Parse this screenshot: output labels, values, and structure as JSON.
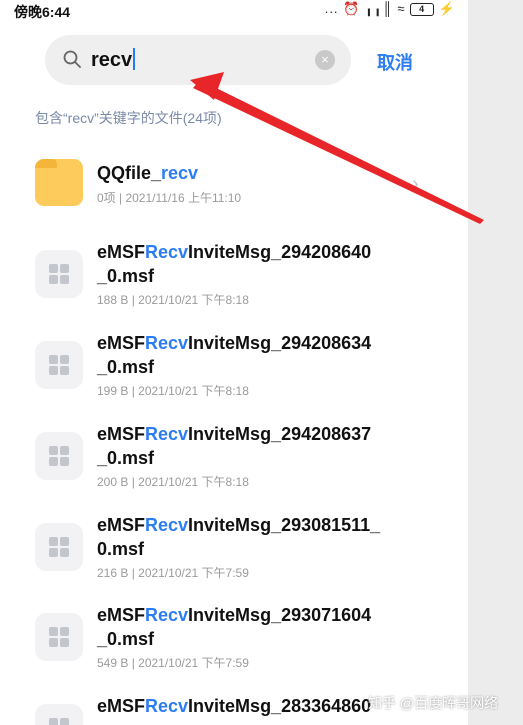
{
  "status_bar": {
    "time": "傍晚6:44",
    "icons": "... ⏰ ╻╻║ ≈",
    "battery": "4"
  },
  "search": {
    "query": "recv",
    "clear_symbol": "×",
    "cancel_label": "取消"
  },
  "summary": "包含“recv”关键字的文件(24项)",
  "items": [
    {
      "kind": "folder",
      "name_prefix": "QQfile_",
      "name_highlight": "recv",
      "name_suffix": "",
      "name_line2": "",
      "meta": "0项  |  2021/11/16 上午11:10"
    },
    {
      "kind": "file",
      "name_prefix": "eMSF",
      "name_highlight": "Recv",
      "name_suffix": "InviteMsg_294208640",
      "name_line2": "_0.msf",
      "meta": "188 B  |  2021/10/21 下午8:18"
    },
    {
      "kind": "file",
      "name_prefix": "eMSF",
      "name_highlight": "Recv",
      "name_suffix": "InviteMsg_294208634",
      "name_line2": "_0.msf",
      "meta": "199 B  |  2021/10/21 下午8:18"
    },
    {
      "kind": "file",
      "name_prefix": "eMSF",
      "name_highlight": "Recv",
      "name_suffix": "InviteMsg_294208637",
      "name_line2": "_0.msf",
      "meta": "200 B  |  2021/10/21 下午8:18"
    },
    {
      "kind": "file",
      "name_prefix": "eMSF",
      "name_highlight": "Recv",
      "name_suffix": "InviteMsg_293081511_",
      "name_line2": "0.msf",
      "meta": "216 B  |  2021/10/21 下午7:59"
    },
    {
      "kind": "file",
      "name_prefix": "eMSF",
      "name_highlight": "Recv",
      "name_suffix": "InviteMsg_293071604",
      "name_line2": "_0.msf",
      "meta": "549 B  |  2021/10/21 下午7:59"
    },
    {
      "kind": "file",
      "name_prefix": "eMSF",
      "name_highlight": "Recv",
      "name_suffix": "InviteMsg_283364860",
      "name_line2": "",
      "meta": ""
    }
  ],
  "watermark": "知乎 @百度晖哥网络",
  "colors": {
    "highlight": "#2c7cf2",
    "annotation_arrow": "#e8262a",
    "folder": "#fccb5c"
  }
}
